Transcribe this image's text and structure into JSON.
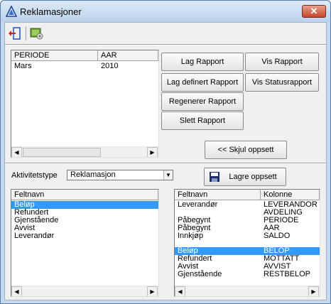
{
  "window": {
    "title": "Reklamasjoner",
    "close_glyph": "✕"
  },
  "toolbar": {
    "icons": [
      "exit-icon",
      "report-settings-icon"
    ]
  },
  "periods": {
    "columns": [
      "PERIODE",
      "AAR"
    ],
    "rows": [
      {
        "periode": "Mars",
        "aar": "2010"
      }
    ]
  },
  "buttons": {
    "lag_rapport": "Lag Rapport",
    "vis_rapport": "Vis Rapport",
    "lag_definert_rapport": "Lag definert Rapport",
    "vis_statusrapport": "Vis Statusrapport",
    "regenerer_rapport": "Regenerer Rapport",
    "slett_rapport": "Slett Rapport",
    "skjul_oppsett": "<< Skjul oppsett",
    "lagre_oppsett": "Lagre oppsett"
  },
  "aktivitet": {
    "label": "Aktivitetstype",
    "value": "Reklamasjon"
  },
  "feltnavn_list": {
    "header": "Feltnavn",
    "items": [
      "Beløp",
      "Refundert",
      "Gjenstående",
      "Avvist",
      "Leverandør"
    ],
    "selected_index": 0
  },
  "mapping_list": {
    "columns": [
      "Feltnavn",
      "Kolonne"
    ],
    "rows": [
      {
        "felt": "Leverandør",
        "kolonne": "LEVERANDOR"
      },
      {
        "felt": "",
        "kolonne": "AVDELING"
      },
      {
        "felt": "Påbegynt",
        "kolonne": "PERIODE"
      },
      {
        "felt": "Påbegynt",
        "kolonne": "AAR"
      },
      {
        "felt": "Innkjøp",
        "kolonne": "SALDO"
      },
      {
        "felt": "Beløp",
        "kolonne": "BELOP"
      },
      {
        "felt": "Refundert",
        "kolonne": "MOTTATT"
      },
      {
        "felt": "Avvist",
        "kolonne": "AVVIST"
      },
      {
        "felt": "Gjenstående",
        "kolonne": "RESTBELOP"
      }
    ],
    "selected_index": 5
  },
  "colors": {
    "selection": "#3399ff",
    "title_accent": "#1f3f9f"
  }
}
